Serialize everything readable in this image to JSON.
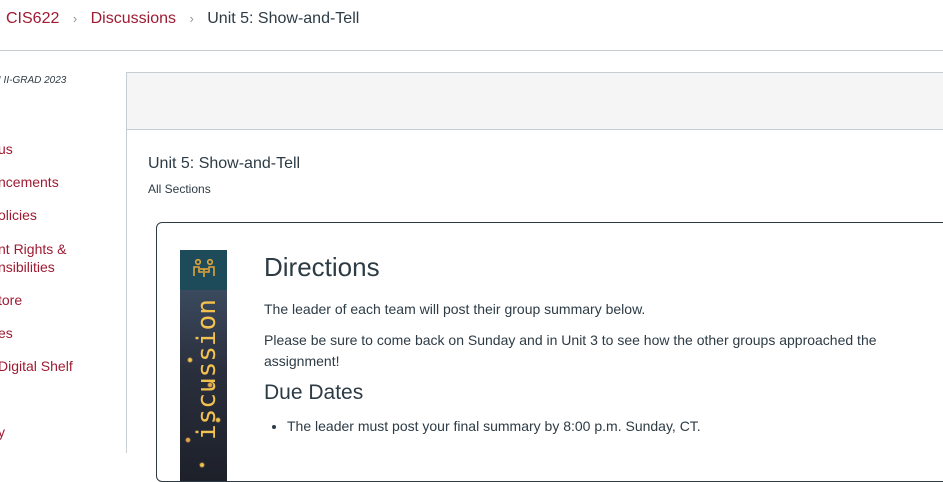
{
  "breadcrumb": {
    "course": "CIS622",
    "discussions": "Discussions",
    "current": "Unit 5: Show-and-Tell",
    "separator": "›"
  },
  "course_nav": {
    "term": "I II-GRAD 2023",
    "items": [
      "us",
      "ncements",
      "olicies",
      "nt Rights &",
      "nsibilities",
      "tore",
      "es",
      "Digital Shelf",
      "y"
    ]
  },
  "topic": {
    "title": "Unit 5: Show-and-Tell",
    "sections": "All Sections"
  },
  "message": {
    "banner_text": "iscussion",
    "banner_icon": "meeting-people-icon",
    "directions_heading": "Directions",
    "paragraph1": "The leader of each team will post their group summary below.",
    "paragraph2": "Please be sure to come back on Sunday and in Unit 3 to see how the other groups approached the assignment!",
    "due_heading": "Due Dates",
    "due_items": [
      "The leader must post your final summary by 8:00 p.m. Sunday, CT."
    ]
  },
  "colors": {
    "link": "#9e1b32",
    "text": "#2d3b45",
    "border": "#c7cdd1",
    "toolbar_bg": "#f5f5f5"
  }
}
